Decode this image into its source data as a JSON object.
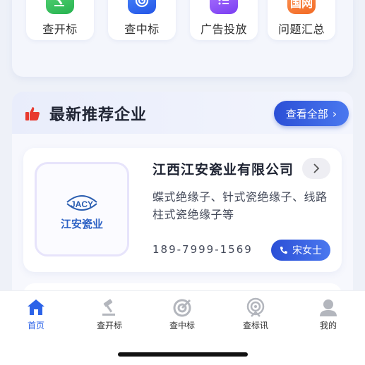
{
  "quick_entries": [
    {
      "label": "查开标",
      "icon": "gavel-icon"
    },
    {
      "label": "查中标",
      "icon": "target-icon"
    },
    {
      "label": "广告投放",
      "icon": "list-icon"
    },
    {
      "label": "问题汇总",
      "icon": "guowang-icon",
      "icon_text": "国网"
    }
  ],
  "recommend": {
    "title": "最新推荐企业",
    "view_all_label": "查看全部",
    "accent_color": "#2b4fd6"
  },
  "company": {
    "name": "江西江安瓷业有限公司",
    "logo_text_top": "JACY",
    "logo_text_bottom": "江安瓷业",
    "description": "蝶式绝缘子、针式瓷绝缘子、线路柱式瓷绝缘子等",
    "phone": "189-7999-1569",
    "contact_label": "宋女士"
  },
  "tabbar": {
    "active_color": "#2c63e8",
    "items": [
      {
        "label": "首页",
        "icon": "home-icon",
        "active": true
      },
      {
        "label": "查开标",
        "icon": "gavel-icon",
        "active": false
      },
      {
        "label": "查中标",
        "icon": "target-icon",
        "active": false
      },
      {
        "label": "查标讯",
        "icon": "radar-icon",
        "active": false
      },
      {
        "label": "我的",
        "icon": "user-icon",
        "active": false
      }
    ]
  }
}
